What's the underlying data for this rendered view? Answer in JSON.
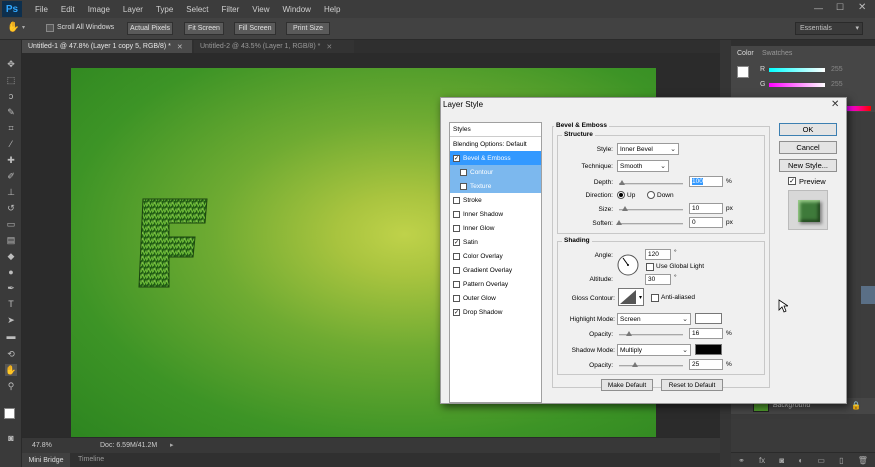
{
  "app": {
    "logo": "Ps"
  },
  "menu": [
    "File",
    "Edit",
    "Image",
    "Layer",
    "Type",
    "Select",
    "Filter",
    "View",
    "Window",
    "Help"
  ],
  "options_bar": {
    "scroll_all": "Scroll All Windows",
    "buttons": [
      "Actual Pixels",
      "Fit Screen",
      "Fill Screen",
      "Print Size"
    ],
    "workspace": "Essentials"
  },
  "tabs": [
    {
      "label": "Untitled-1 @ 47.8% (Layer 1 copy 5, RGB/8) *",
      "active": true
    },
    {
      "label": "Untitled-2 @ 43.5% (Layer 1, RGB/8) *",
      "active": false
    }
  ],
  "canvas": {
    "letter": "F"
  },
  "status": {
    "zoom": "47.8%",
    "doc": "Doc: 6.59M/41.2M"
  },
  "bottom_tabs": [
    "Mini Bridge",
    "Timeline"
  ],
  "color_panel": {
    "tabs": [
      "Color",
      "Swatches"
    ],
    "channels": [
      {
        "label": "R",
        "value": "255"
      },
      {
        "label": "G",
        "value": "255"
      },
      {
        "label": "B",
        "value": "255"
      }
    ]
  },
  "layers": {
    "background_label": "Background"
  },
  "dialog": {
    "title": "Layer Style",
    "styles_header": "Styles",
    "styles": [
      {
        "label": "Blending Options: Default",
        "checkbox": false,
        "checked": false,
        "state": "normal"
      },
      {
        "label": "Bevel & Emboss",
        "checkbox": true,
        "checked": true,
        "state": "selected"
      },
      {
        "label": "Contour",
        "checkbox": true,
        "checked": false,
        "state": "sub"
      },
      {
        "label": "Texture",
        "checkbox": true,
        "checked": false,
        "state": "sub"
      },
      {
        "label": "Stroke",
        "checkbox": true,
        "checked": false,
        "state": "normal"
      },
      {
        "label": "Inner Shadow",
        "checkbox": true,
        "checked": false,
        "state": "normal"
      },
      {
        "label": "Inner Glow",
        "checkbox": true,
        "checked": false,
        "state": "normal"
      },
      {
        "label": "Satin",
        "checkbox": true,
        "checked": true,
        "state": "normal"
      },
      {
        "label": "Color Overlay",
        "checkbox": true,
        "checked": false,
        "state": "normal"
      },
      {
        "label": "Gradient Overlay",
        "checkbox": true,
        "checked": false,
        "state": "normal"
      },
      {
        "label": "Pattern Overlay",
        "checkbox": true,
        "checked": false,
        "state": "normal"
      },
      {
        "label": "Outer Glow",
        "checkbox": true,
        "checked": false,
        "state": "normal"
      },
      {
        "label": "Drop Shadow",
        "checkbox": true,
        "checked": true,
        "state": "normal"
      }
    ],
    "bevel": {
      "title": "Bevel & Emboss",
      "structure": "Structure",
      "style_label": "Style:",
      "style_value": "Inner Bevel",
      "technique_label": "Technique:",
      "technique_value": "Smooth",
      "depth_label": "Depth:",
      "depth_value": "100",
      "depth_unit": "%",
      "direction_label": "Direction:",
      "up": "Up",
      "down": "Down",
      "direction_value": "Up",
      "size_label": "Size:",
      "size_value": "10",
      "size_unit": "px",
      "soften_label": "Soften:",
      "soften_value": "0",
      "soften_unit": "px"
    },
    "shading": {
      "title": "Shading",
      "angle_label": "Angle:",
      "angle_value": "120",
      "angle_unit": "°",
      "global_light": "Use Global Light",
      "altitude_label": "Altitude:",
      "altitude_value": "30",
      "altitude_unit": "°",
      "gloss_label": "Gloss Contour:",
      "anti_aliased": "Anti-aliased",
      "highlight_label": "Highlight Mode:",
      "highlight_value": "Screen",
      "highlight_color": "#ffffff",
      "opacity_label": "Opacity:",
      "highlight_opacity": "16",
      "opacity_unit": "%",
      "shadow_label": "Shadow Mode:",
      "shadow_value": "Multiply",
      "shadow_color": "#000000",
      "shadow_opacity": "25"
    },
    "buttons": {
      "make_default": "Make Default",
      "reset_default": "Reset to Default",
      "ok": "OK",
      "cancel": "Cancel",
      "new_style": "New Style...",
      "preview": "Preview"
    }
  }
}
